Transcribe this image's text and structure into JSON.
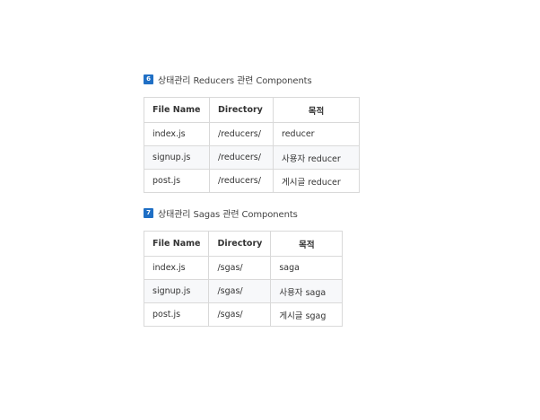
{
  "sections": [
    {
      "number": "6",
      "title": "상태관리 Reducers 관련 Components",
      "headers": [
        "File Name",
        "Directory",
        "목적"
      ],
      "rows": [
        [
          "index.js",
          "/reducers/",
          "reducer"
        ],
        [
          "signup.js",
          "/reducers/",
          "사용자 reducer"
        ],
        [
          "post.js",
          "/reducers/",
          "게시글 reducer"
        ]
      ]
    },
    {
      "number": "7",
      "title": "상태관리 Sagas 관련 Components",
      "headers": [
        "File Name",
        "Directory",
        "목적"
      ],
      "rows": [
        [
          "index.js",
          "/sgas/",
          "saga"
        ],
        [
          "signup.js",
          "/sgas/",
          "사용자 saga"
        ],
        [
          "post.js",
          "/sgas/",
          "게시글 sgag"
        ]
      ]
    }
  ],
  "colors": {
    "badge": "#1f6fc5",
    "border": "#d9d9d9",
    "alt_row": "#f7f8fa"
  }
}
